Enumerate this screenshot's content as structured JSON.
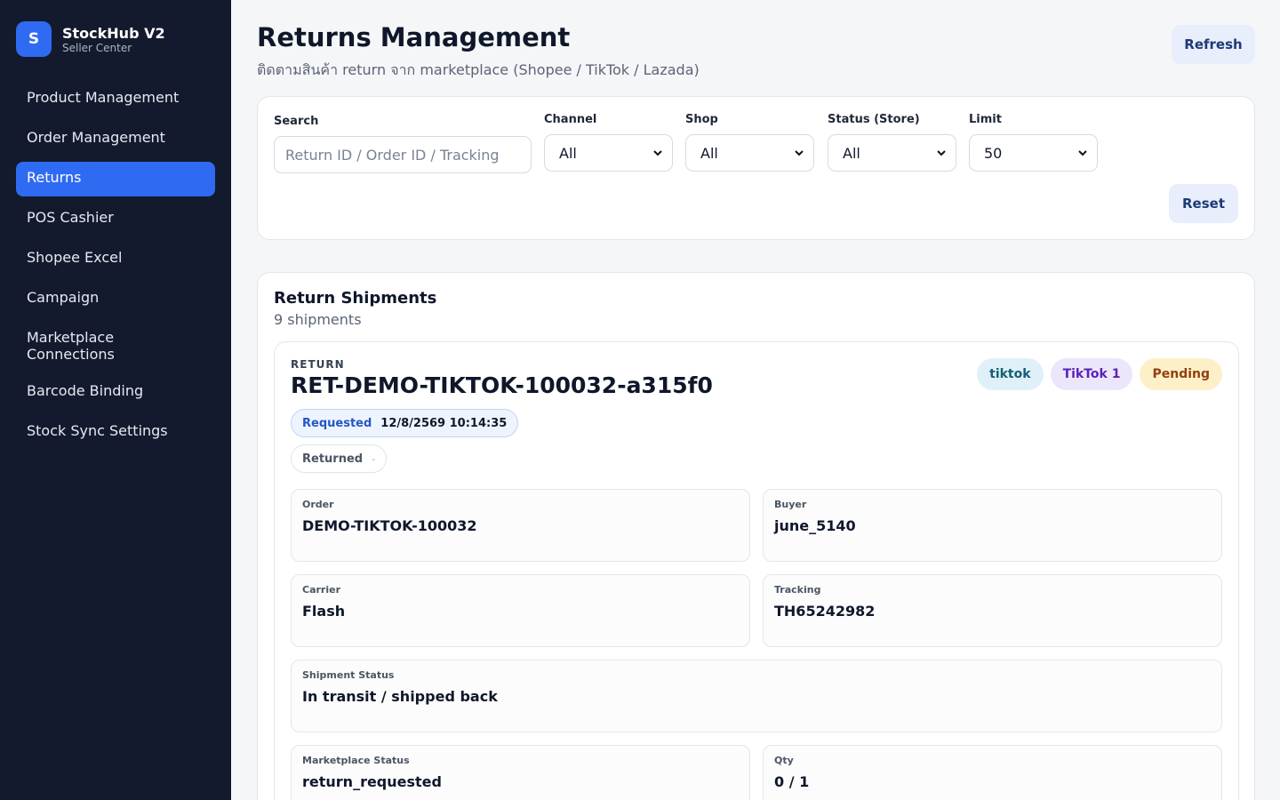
{
  "brand": {
    "logo_letter": "S",
    "name": "StockHub V2",
    "subtitle": "Seller Center"
  },
  "sidebar": {
    "items": [
      {
        "label": "Product Management"
      },
      {
        "label": "Order Management"
      },
      {
        "label": "Returns",
        "active": true
      },
      {
        "label": "POS Cashier"
      },
      {
        "label": "Shopee Excel"
      },
      {
        "label": "Campaign"
      },
      {
        "label": "Marketplace Connections"
      },
      {
        "label": "Barcode Binding"
      },
      {
        "label": "Stock Sync Settings"
      }
    ]
  },
  "header": {
    "title": "Returns Management",
    "subtitle": "ติดตามสินค้า return จาก marketplace (Shopee / TikTok / Lazada)",
    "refresh_label": "Refresh"
  },
  "filters": {
    "search_label": "Search",
    "search_placeholder": "Return ID / Order ID / Tracking",
    "channel_label": "Channel",
    "channel_value": "All",
    "shop_label": "Shop",
    "shop_value": "All",
    "status_label": "Status (Store)",
    "status_value": "All",
    "limit_label": "Limit",
    "limit_value": "50",
    "reset_label": "Reset"
  },
  "shipments": {
    "title": "Return Shipments",
    "count": "9 shipments",
    "items": [
      {
        "kicker": "RETURN",
        "return_id": "RET-DEMO-TIKTOK-100032-a315f0",
        "channel": "tiktok",
        "shop": "TikTok 1",
        "status": "Pending",
        "requested_label": "Requested",
        "requested_value": "12/8/2569 10:14:35",
        "returned_label": "Returned",
        "returned_value": "-",
        "order_label": "Order",
        "order_value": "DEMO-TIKTOK-100032",
        "buyer_label": "Buyer",
        "buyer_value": "june_5140",
        "carrier_label": "Carrier",
        "carrier_value": "Flash",
        "tracking_label": "Tracking",
        "tracking_value": "TH65242982",
        "shipment_status_label": "Shipment Status",
        "shipment_status_value": "In transit / shipped back",
        "marketplace_status_label": "Marketplace Status",
        "marketplace_status_value": "return_requested",
        "qty_label": "Qty",
        "qty_value": "0 / 1"
      }
    ]
  },
  "colors": {
    "sidebar_bg": "#141a2e",
    "accent": "#2f6bf2",
    "page_bg": "#f5f6f8"
  }
}
